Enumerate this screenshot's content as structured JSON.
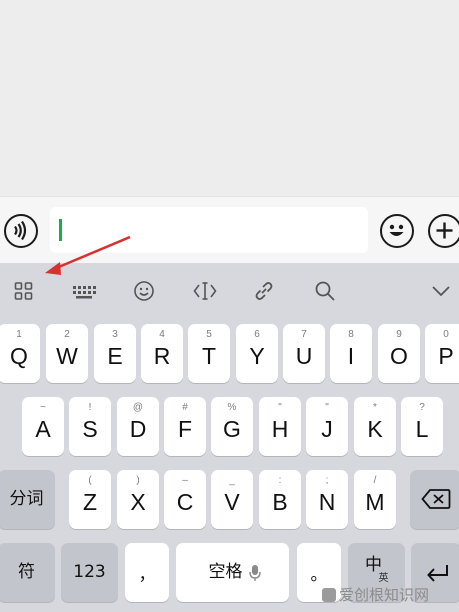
{
  "input_bar": {
    "voice_icon": "voice-icon",
    "emoji_icon": "smiley-icon",
    "plus_icon": "plus-icon",
    "text_value": ""
  },
  "toolbar": {
    "icons": [
      "grid-icon",
      "keyboard-icon",
      "emoji-icon",
      "text-cursor-icon",
      "link-icon",
      "search-icon",
      "chevron-down-icon"
    ]
  },
  "keyboard": {
    "row1": [
      {
        "main": "Q",
        "sub": "1"
      },
      {
        "main": "W",
        "sub": "2"
      },
      {
        "main": "E",
        "sub": "3"
      },
      {
        "main": "R",
        "sub": "4"
      },
      {
        "main": "T",
        "sub": "5"
      },
      {
        "main": "Y",
        "sub": "6"
      },
      {
        "main": "U",
        "sub": "7"
      },
      {
        "main": "I",
        "sub": "8"
      },
      {
        "main": "O",
        "sub": "9"
      },
      {
        "main": "P",
        "sub": "0"
      }
    ],
    "row2": [
      {
        "main": "A",
        "sub": "~"
      },
      {
        "main": "S",
        "sub": "!"
      },
      {
        "main": "D",
        "sub": "@"
      },
      {
        "main": "F",
        "sub": "#"
      },
      {
        "main": "G",
        "sub": "%"
      },
      {
        "main": "H",
        "sub": "\""
      },
      {
        "main": "J",
        "sub": "\""
      },
      {
        "main": "K",
        "sub": "*"
      },
      {
        "main": "L",
        "sub": "?"
      }
    ],
    "row3": [
      {
        "main": "Z",
        "sub": "("
      },
      {
        "main": "X",
        "sub": ")"
      },
      {
        "main": "C",
        "sub": "–"
      },
      {
        "main": "V",
        "sub": "_"
      },
      {
        "main": "B",
        "sub": ":"
      },
      {
        "main": "N",
        "sub": ";"
      },
      {
        "main": "M",
        "sub": "/"
      }
    ],
    "fenci_label": "分词",
    "backspace_icon": "backspace-icon",
    "symbol_label": "符",
    "num_label": "123",
    "comma_label": "，",
    "space_label": "空格",
    "mic_icon": "microphone-icon",
    "period_label": "。",
    "lang_main": "中",
    "lang_sub": "英",
    "enter_icon": "enter-icon"
  },
  "watermark": {
    "text": "爱创根知识网"
  }
}
